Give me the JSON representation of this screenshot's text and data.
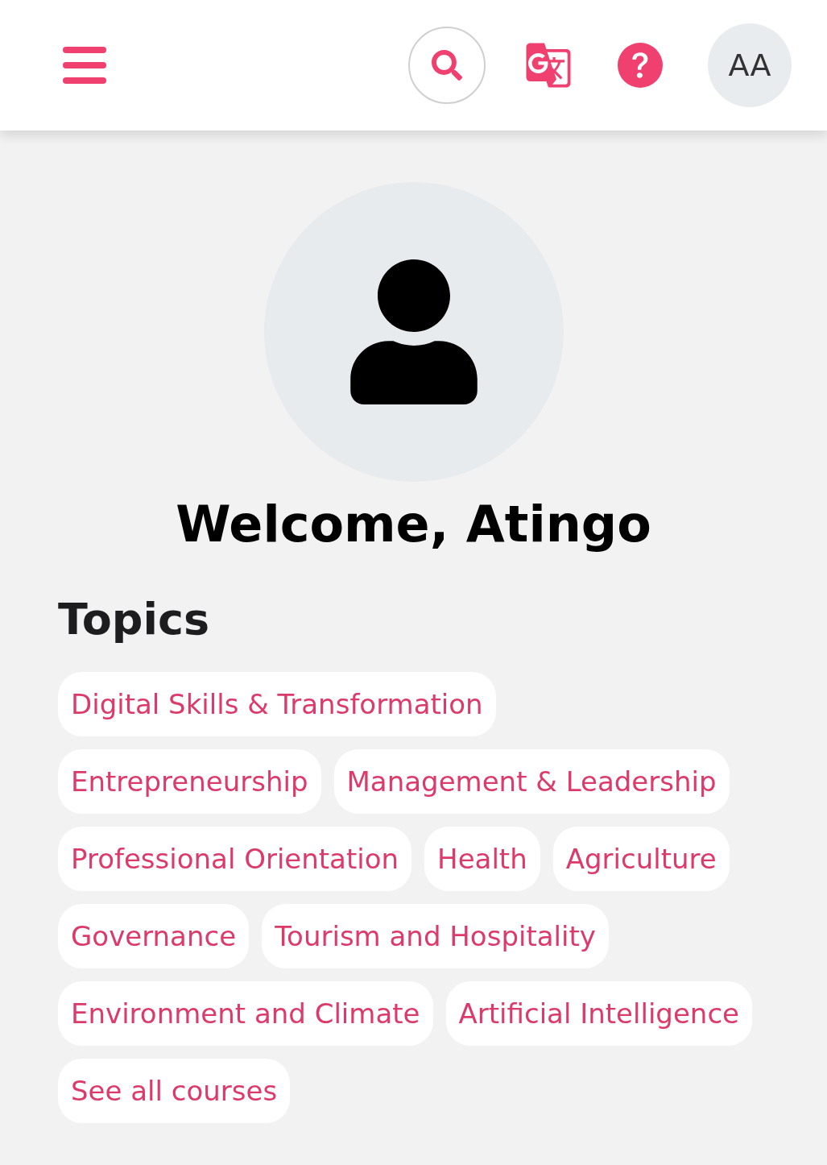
{
  "header": {
    "avatar_initials": "AA"
  },
  "welcome": "Welcome, Atingo",
  "topics": {
    "title": "Topics",
    "rows": [
      [
        {
          "label": "Digital Skills & Transformation"
        }
      ],
      [
        {
          "label": "Entrepreneurship"
        },
        {
          "label": "Management & Leadership"
        }
      ],
      [
        {
          "label": "Professional Orientation"
        },
        {
          "label": "Health"
        },
        {
          "label": "Agriculture"
        }
      ],
      [
        {
          "label": "Governance"
        },
        {
          "label": "Tourism and Hospitality"
        }
      ],
      [
        {
          "label": "Environment and Climate"
        },
        {
          "label": "Artificial Intelligence"
        }
      ],
      [
        {
          "label": "See all courses"
        }
      ]
    ]
  }
}
